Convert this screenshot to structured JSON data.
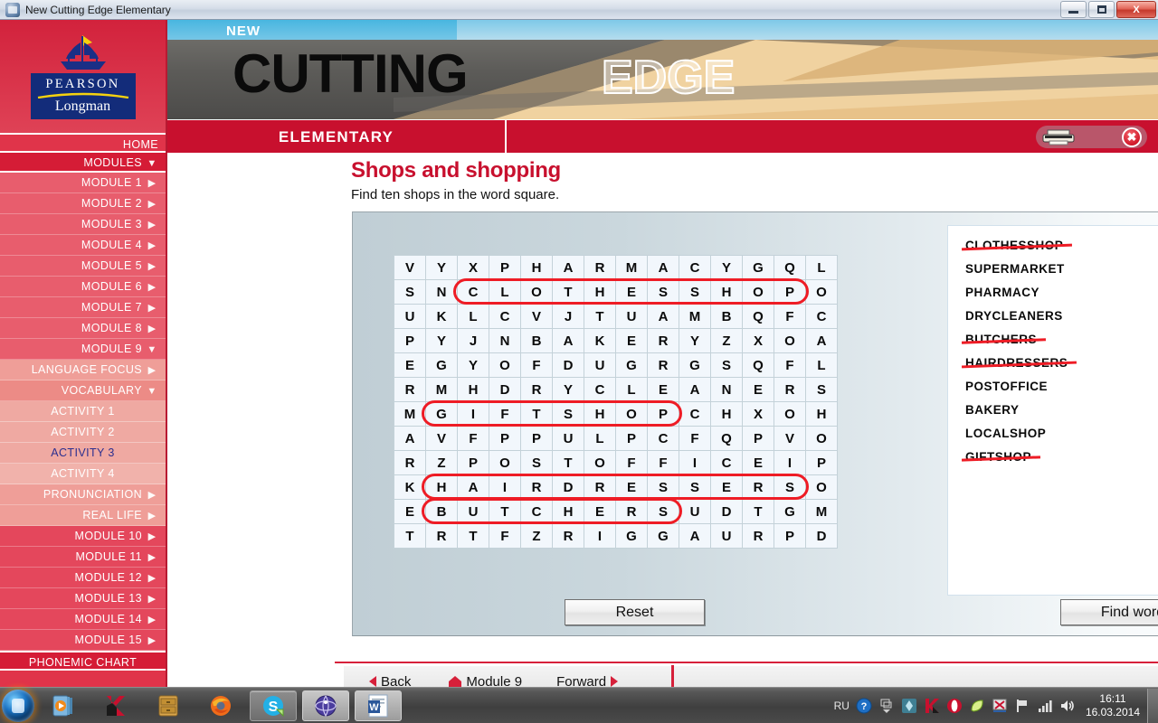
{
  "window": {
    "title": "New Cutting Edge Elementary",
    "minimize_label": "Minimize",
    "restore_label": "Restore",
    "close_label": "X"
  },
  "sidebar": {
    "logo": {
      "brand": "PEARSON",
      "sub": "Longman"
    },
    "items": [
      {
        "label": "HOME",
        "arrow": "",
        "style": "home"
      },
      {
        "label": "MODULES",
        "arrow": "▼",
        "style": "modules"
      },
      {
        "label": "MODULE 1",
        "arrow": "▶",
        "style": "mod"
      },
      {
        "label": "MODULE 2",
        "arrow": "▶",
        "style": "mod"
      },
      {
        "label": "MODULE 3",
        "arrow": "▶",
        "style": "mod"
      },
      {
        "label": "MODULE 4",
        "arrow": "▶",
        "style": "mod"
      },
      {
        "label": "MODULE 5",
        "arrow": "▶",
        "style": "mod"
      },
      {
        "label": "MODULE 6",
        "arrow": "▶",
        "style": "mod"
      },
      {
        "label": "MODULE 7",
        "arrow": "▶",
        "style": "mod"
      },
      {
        "label": "MODULE 8",
        "arrow": "▶",
        "style": "mod"
      },
      {
        "label": "MODULE 9",
        "arrow": "▼",
        "style": "mod"
      },
      {
        "label": "LANGUAGE FOCUS",
        "arrow": "▶",
        "style": "sub"
      },
      {
        "label": "VOCABULARY",
        "arrow": "▼",
        "style": "sub focus"
      },
      {
        "label": "ACTIVITY 1",
        "arrow": "",
        "style": "act"
      },
      {
        "label": "ACTIVITY 2",
        "arrow": "",
        "style": "act"
      },
      {
        "label": "ACTIVITY 3",
        "arrow": "",
        "style": "act cur"
      },
      {
        "label": "ACTIVITY 4",
        "arrow": "",
        "style": "act alt"
      },
      {
        "label": "PRONUNCIATION",
        "arrow": "▶",
        "style": "sub"
      },
      {
        "label": "REAL LIFE",
        "arrow": "▶",
        "style": "sub"
      },
      {
        "label": "MODULE 10",
        "arrow": "▶",
        "style": "modlate"
      },
      {
        "label": "MODULE 11",
        "arrow": "▶",
        "style": "modlate"
      },
      {
        "label": "MODULE 12",
        "arrow": "▶",
        "style": "modlate"
      },
      {
        "label": "MODULE 13",
        "arrow": "▶",
        "style": "modlate"
      },
      {
        "label": "MODULE 14",
        "arrow": "▶",
        "style": "modlate"
      },
      {
        "label": "MODULE 15",
        "arrow": "▶",
        "style": "modlate"
      },
      {
        "label": "PHONEMIC CHART",
        "arrow": "",
        "style": "phon"
      }
    ]
  },
  "banner": {
    "new": "NEW",
    "cutting": "CUTTING",
    "edge": "EDGE",
    "level": "ELEMENTARY",
    "print_label": "Print",
    "close_label": "✖"
  },
  "exercise": {
    "title": "Shops and shopping",
    "instruction": "Find ten shops in the word square.",
    "reset_label": "Reset",
    "find_label": "Find word",
    "grid": {
      "rows": 13,
      "cols": 14,
      "letters": [
        [
          "V",
          "Y",
          "X",
          "P",
          "H",
          "A",
          "R",
          "M",
          "A",
          "C",
          "Y",
          "G",
          "Q",
          "L"
        ],
        [
          "S",
          "N",
          "C",
          "L",
          "O",
          "T",
          "H",
          "E",
          "S",
          "S",
          "H",
          "O",
          "P",
          "O"
        ],
        [
          "U",
          "K",
          "L",
          "C",
          "V",
          "J",
          "T",
          "U",
          "A",
          "M",
          "B",
          "Q",
          "F",
          "C"
        ],
        [
          "P",
          "Y",
          "J",
          "N",
          "B",
          "A",
          "K",
          "E",
          "R",
          "Y",
          "Z",
          "X",
          "O",
          "A"
        ],
        [
          "E",
          "G",
          "Y",
          "O",
          "F",
          "D",
          "U",
          "G",
          "R",
          "G",
          "S",
          "Q",
          "F",
          "L"
        ],
        [
          "R",
          "M",
          "H",
          "D",
          "R",
          "Y",
          "C",
          "L",
          "E",
          "A",
          "N",
          "E",
          "R",
          "S"
        ],
        [
          "M",
          "G",
          "I",
          "F",
          "T",
          "S",
          "H",
          "O",
          "P",
          "C",
          "H",
          "X",
          "O",
          "H"
        ],
        [
          "A",
          "V",
          "F",
          "P",
          "P",
          "U",
          "L",
          "P",
          "C",
          "F",
          "Q",
          "P",
          "V",
          "O"
        ],
        [
          "R",
          "Z",
          "P",
          "O",
          "S",
          "T",
          "O",
          "F",
          "F",
          "I",
          "C",
          "E",
          "I",
          "P"
        ],
        [
          "K",
          "H",
          "A",
          "I",
          "R",
          "D",
          "R",
          "E",
          "S",
          "S",
          "E",
          "R",
          "S",
          "O"
        ],
        [
          "E",
          "B",
          "U",
          "T",
          "C",
          "H",
          "E",
          "R",
          "S",
          "U",
          "D",
          "T",
          "G",
          "M"
        ],
        [
          "T",
          "R",
          "T",
          "F",
          "Z",
          "R",
          "I",
          "G",
          "G",
          "A",
          "U",
          "R",
          "P",
          "D"
        ]
      ],
      "found_markers": [
        {
          "word": "CLOTHESSHOP",
          "row": 1,
          "col_start": 2,
          "col_end": 12
        },
        {
          "word": "GIFTSHOP",
          "row": 6,
          "col_start": 1,
          "col_end": 8
        },
        {
          "word": "HAIRDRESSERS",
          "row": 9,
          "col_start": 1,
          "col_end": 12
        },
        {
          "word": "BUTCHERS",
          "row": 10,
          "col_start": 1,
          "col_end": 8
        }
      ]
    },
    "word_list": [
      {
        "label": "CLOTHESSHOP",
        "found": true
      },
      {
        "label": "SUPERMARKET",
        "found": false
      },
      {
        "label": "PHARMACY",
        "found": false
      },
      {
        "label": "DRYCLEANERS",
        "found": false
      },
      {
        "label": "BUTCHERS",
        "found": true
      },
      {
        "label": "HAIRDRESSERS",
        "found": true
      },
      {
        "label": "POSTOFFICE",
        "found": false
      },
      {
        "label": "BAKERY",
        "found": false
      },
      {
        "label": "LOCALSHOP",
        "found": false
      },
      {
        "label": "GIFTSHOP",
        "found": true
      }
    ]
  },
  "bottom_nav": {
    "back": "Back",
    "module": "Module 9",
    "forward": "Forward"
  },
  "taskbar": {
    "language": "RU",
    "time": "16:11",
    "date": "16.03.2014"
  },
  "colors": {
    "brand_red": "#c8102e",
    "sidebar_red": "#e0344a",
    "marker_red": "#ee1c25",
    "logo_blue": "#132c7a"
  }
}
